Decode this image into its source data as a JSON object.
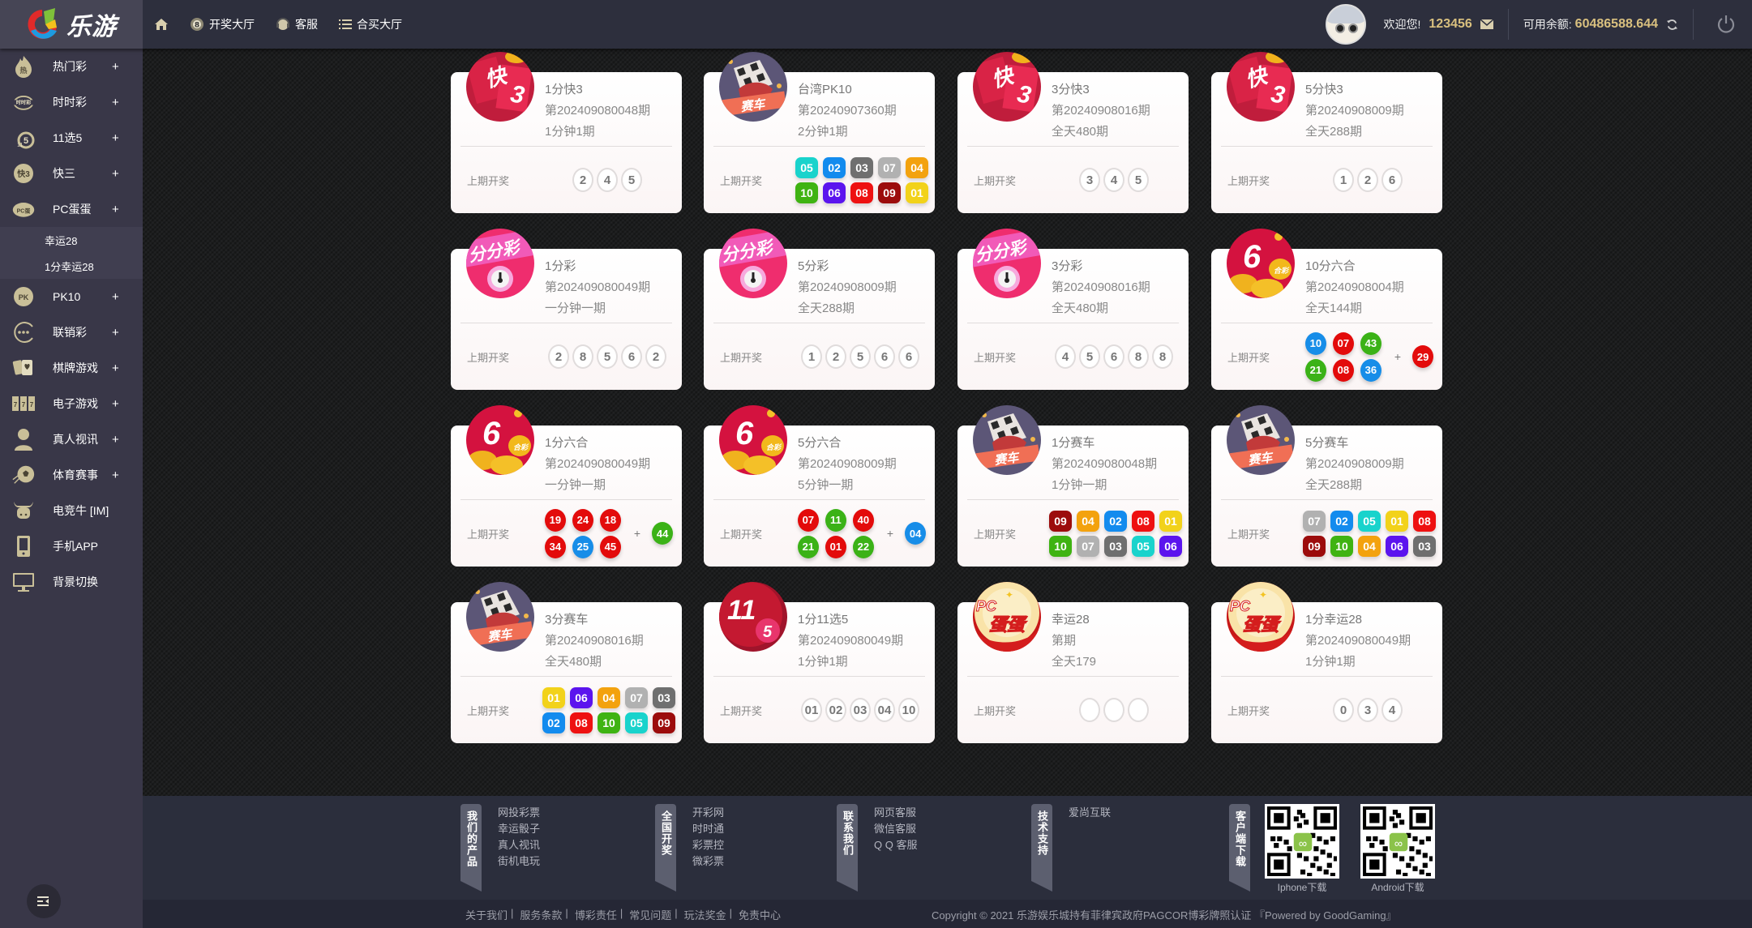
{
  "header": {
    "logo_text": "乐游",
    "nav": [
      {
        "label": "",
        "icon": "home-icon"
      },
      {
        "label": "开奖大厅",
        "icon": "lottery-ball-icon"
      },
      {
        "label": "客服",
        "icon": "headset-icon"
      },
      {
        "label": "合买大厅",
        "icon": "list-icon"
      }
    ],
    "welcome_label": "欢迎您!",
    "username": "123456",
    "balance_label": "可用余额:",
    "balance": "60486588.644",
    "colors": {
      "gold": "#d9c07f",
      "header_bg": "#2d2f3d",
      "logo_bg": "#464555"
    }
  },
  "sidebar": {
    "items": [
      {
        "label": "热门彩",
        "icon": "fire-icon",
        "expand": "+"
      },
      {
        "label": "时时彩",
        "icon": "timer-lottery-icon",
        "expand": "+"
      },
      {
        "label": "11选5",
        "icon": "eleven-five-icon",
        "expand": "+"
      },
      {
        "label": "快三",
        "icon": "dice-icon",
        "expand": "+"
      },
      {
        "label": "PC蛋蛋",
        "icon": "pc-egg-icon",
        "expand": "+"
      },
      {
        "label": "PK10",
        "icon": "pk10-icon",
        "expand": "+"
      },
      {
        "label": "联销彩",
        "icon": "more-icon",
        "expand": "+"
      },
      {
        "label": "棋牌游戏",
        "icon": "cards-icon",
        "expand": "+"
      },
      {
        "label": "电子游戏",
        "icon": "slot-machine-icon",
        "expand": "+"
      },
      {
        "label": "真人视讯",
        "icon": "dealer-icon",
        "expand": "+"
      },
      {
        "label": "体育赛事",
        "icon": "soccer-ball-icon",
        "expand": "+"
      },
      {
        "label": "电竞牛 [IM]",
        "icon": "bull-icon",
        "expand": ""
      },
      {
        "label": "手机APP",
        "icon": "mobile-phone-icon",
        "expand": ""
      },
      {
        "label": "背景切换",
        "icon": "monitor-icon",
        "expand": ""
      }
    ],
    "submenu": [
      "幸运28",
      "1分幸运28"
    ]
  },
  "draw_label": "上期开奖",
  "cards": [
    {
      "name": "1分快3",
      "issue": "第202409080048期",
      "freq": "1分钟1期",
      "icon": "kuai3",
      "type": "plain",
      "numbers": [
        "2",
        "4",
        "5"
      ]
    },
    {
      "name": "台湾PK10",
      "issue": "第20240907360期",
      "freq": "2分钟1期",
      "icon": "saiche",
      "type": "pk10",
      "numbers": [
        "05",
        "02",
        "03",
        "07",
        "04",
        "10",
        "06",
        "08",
        "09",
        "01"
      ]
    },
    {
      "name": "3分快3",
      "issue": "第20240908016期",
      "freq": "全天480期",
      "icon": "kuai3",
      "type": "plain",
      "numbers": [
        "3",
        "4",
        "5"
      ]
    },
    {
      "name": "5分快3",
      "issue": "第20240908009期",
      "freq": "全天288期",
      "icon": "kuai3",
      "type": "plain",
      "numbers": [
        "1",
        "2",
        "6"
      ]
    },
    {
      "name": "1分彩",
      "issue": "第202409080049期",
      "freq": "一分钟一期",
      "icon": "fenfencai",
      "type": "plain",
      "numbers": [
        "2",
        "8",
        "5",
        "6",
        "2"
      ]
    },
    {
      "name": "5分彩",
      "issue": "第20240908009期",
      "freq": "全天288期",
      "icon": "fenfencai",
      "type": "plain",
      "numbers": [
        "1",
        "2",
        "5",
        "6",
        "6"
      ]
    },
    {
      "name": "3分彩",
      "issue": "第20240908016期",
      "freq": "全天480期",
      "icon": "fenfencai",
      "type": "plain",
      "numbers": [
        "4",
        "5",
        "6",
        "8",
        "8"
      ]
    },
    {
      "name": "10分六合",
      "issue": "第20240908004期",
      "freq": "全天144期",
      "icon": "liuhecai",
      "type": "six",
      "numbers": [
        "10",
        "07",
        "43",
        "21",
        "08",
        "36"
      ],
      "special": "29",
      "colors": [
        "blue",
        "red",
        "green",
        "green",
        "red",
        "blue"
      ],
      "special_color": "red"
    },
    {
      "name": "1分六合",
      "issue": "第202409080049期",
      "freq": "一分钟一期",
      "icon": "liuhecai",
      "type": "six",
      "numbers": [
        "19",
        "24",
        "18",
        "34",
        "25",
        "45"
      ],
      "special": "44",
      "colors": [
        "red",
        "red",
        "red",
        "red",
        "blue",
        "red"
      ],
      "special_color": "green"
    },
    {
      "name": "5分六合",
      "issue": "第20240908009期",
      "freq": "5分钟一期",
      "icon": "liuhecai",
      "type": "six",
      "numbers": [
        "07",
        "11",
        "40",
        "21",
        "01",
        "22"
      ],
      "special": "04",
      "colors": [
        "red",
        "green",
        "red",
        "green",
        "red",
        "green"
      ],
      "special_color": "blue"
    },
    {
      "name": "1分赛车",
      "issue": "第202409080048期",
      "freq": "1分钟一期",
      "icon": "saiche",
      "type": "pk10",
      "numbers": [
        "09",
        "04",
        "02",
        "08",
        "01",
        "10",
        "07",
        "03",
        "05",
        "06"
      ]
    },
    {
      "name": "5分赛车",
      "issue": "第20240908009期",
      "freq": "全天288期",
      "icon": "saiche",
      "type": "pk10",
      "numbers": [
        "07",
        "02",
        "05",
        "01",
        "08",
        "09",
        "10",
        "04",
        "06",
        "03"
      ]
    },
    {
      "name": "3分赛车",
      "issue": "第20240908016期",
      "freq": "全天480期",
      "icon": "saiche",
      "type": "pk10",
      "numbers": [
        "01",
        "06",
        "04",
        "07",
        "03",
        "02",
        "08",
        "10",
        "05",
        "09"
      ]
    },
    {
      "name": "1分11选5",
      "issue": "第202409080049期",
      "freq": "1分钟1期",
      "icon": "eleven5",
      "type": "plain",
      "numbers": [
        "01",
        "02",
        "03",
        "04",
        "10"
      ]
    },
    {
      "name": "幸运28",
      "issue": "第期",
      "freq": "全天179",
      "icon": "pcdandan",
      "type": "plain",
      "numbers": [
        "",
        "",
        ""
      ]
    },
    {
      "name": "1分幸运28",
      "issue": "第202409080049期",
      "freq": "1分钟1期",
      "icon": "pcdandan",
      "type": "plain",
      "numbers": [
        "0",
        "3",
        "4"
      ]
    }
  ],
  "pk10_colors": {
    "01": "#f2d21a",
    "02": "#138bee",
    "03": "#6f6f6f",
    "04": "#f3a20e",
    "05": "#19d3cc",
    "06": "#5b14ee",
    "07": "#b1b1b1",
    "08": "#ee1111",
    "09": "#9c0c0c",
    "10": "#3fb312"
  },
  "six_colors": {
    "red": "#e30b0b",
    "green": "#3bb217",
    "blue": "#178de8"
  },
  "footer": {
    "columns": [
      {
        "tag": "我们的产品",
        "links": [
          "网投彩票",
          "幸运骰子",
          "真人视讯",
          "街机电玩"
        ]
      },
      {
        "tag": "全国开奖",
        "links": [
          "开彩网",
          "时时通",
          "彩票控",
          "微彩票"
        ]
      },
      {
        "tag": "联系我们",
        "links": [
          "网页客服",
          "微信客服",
          "Q Q 客服"
        ]
      },
      {
        "tag": "技术支持",
        "links": [
          "爱尚互联"
        ]
      }
    ],
    "download_tag": "客户端下载",
    "qr": [
      {
        "label": "Iphone下载"
      },
      {
        "label": "Android下载"
      }
    ],
    "bottom_links": [
      "关于我们",
      "服务条款",
      "博彩责任",
      "常见问题",
      "玩法奖金",
      "免责中心"
    ],
    "copyright": "Copyright © 2021 乐游娱乐城持有菲律宾政府PAGCOR博彩牌照认证 『Powered by GoodGaming』"
  }
}
